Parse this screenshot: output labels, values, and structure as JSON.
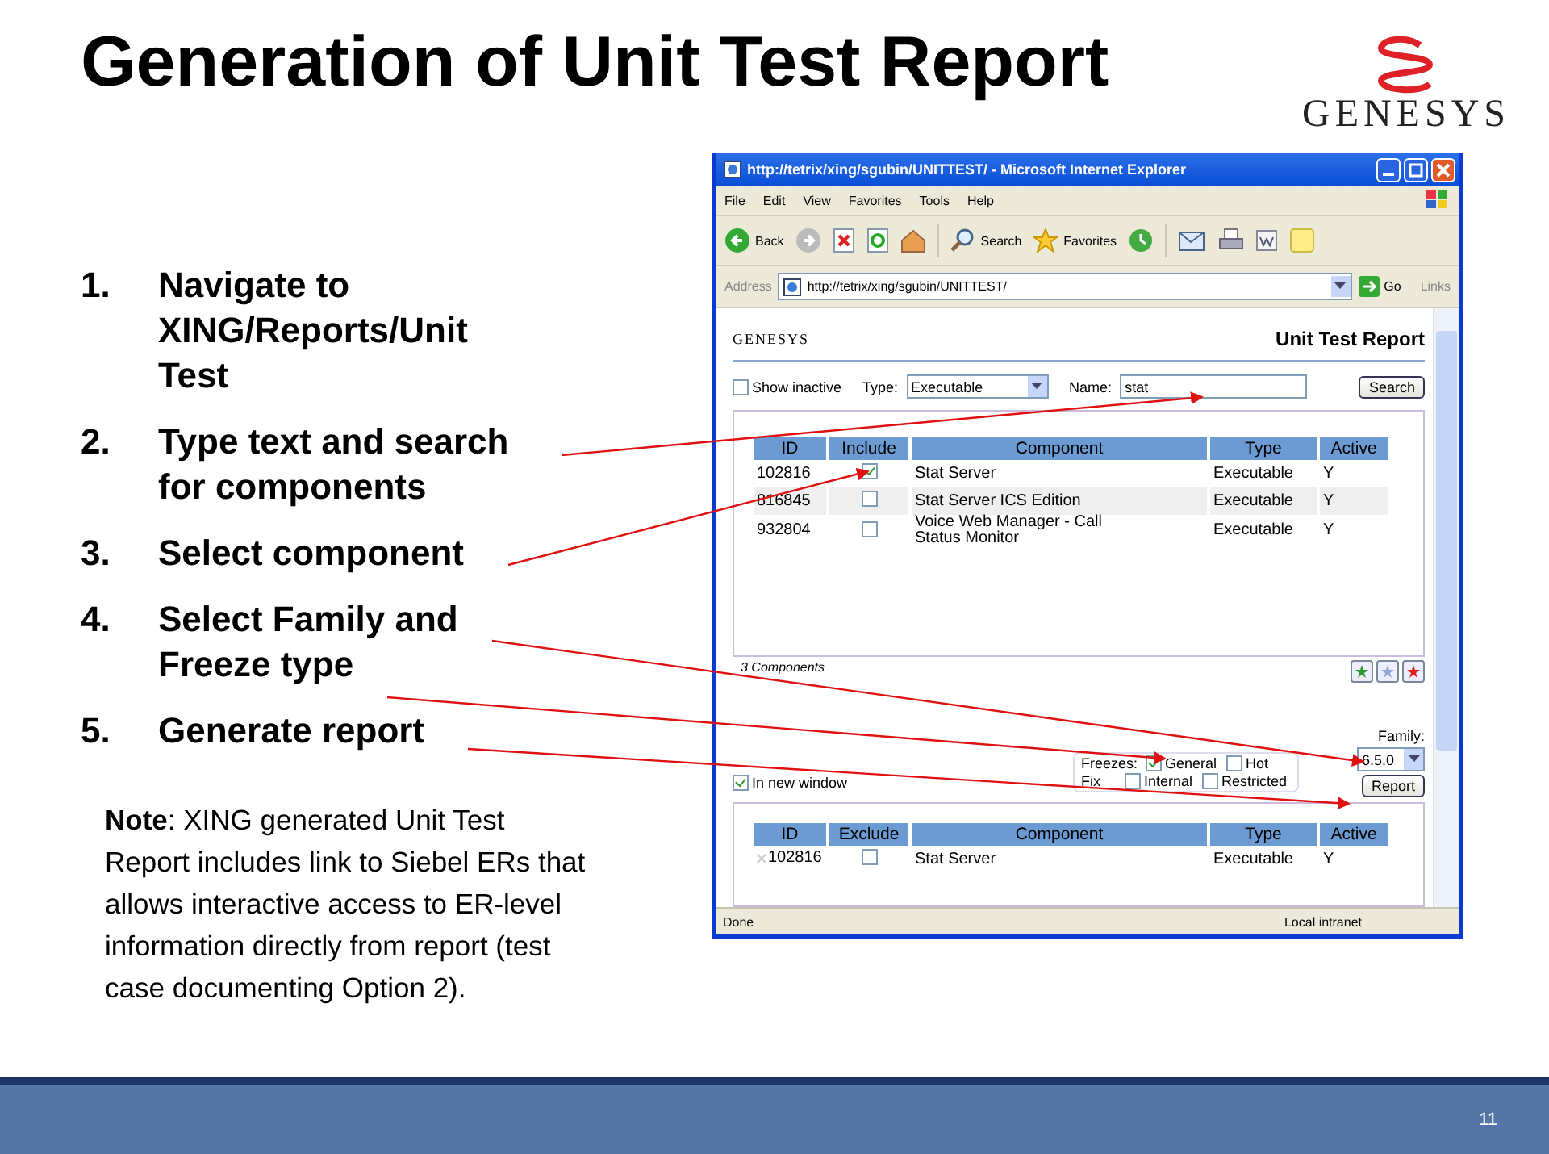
{
  "title": "Generation of Unit Test Report",
  "logo": "GENESYS",
  "steps": [
    {
      "number": "1.",
      "text": "Navigate to XING/Reports/Unit Test"
    },
    {
      "number": "2.",
      "text": "Type text and search for components"
    },
    {
      "number": "3.",
      "text": "Select component"
    },
    {
      "number": "4.",
      "text": "Select Family and Freeze type"
    },
    {
      "number": "5.",
      "text": "Generate report"
    }
  ],
  "note": "**Note**: XING generated Unit Test Report includes link to Siebel ERs that allows interactive access to ER-level information directly from report (test case documenting Option 2).",
  "browser": {
    "window_title": "http://tetrix/xing/sgubin/UNITTEST/ - Microsoft Internet Explorer",
    "menu": [
      "File",
      "Edit",
      "View",
      "Favorites",
      "Tools",
      "Help"
    ],
    "toolbar": {
      "back": "Back",
      "search": "Search",
      "favorites": "Favorites"
    },
    "address_label": "Address",
    "url": "http://tetrix/xing/sgubin/UNITTEST/",
    "go": "Go",
    "links": "Links",
    "page": {
      "logo": "GENESYS",
      "heading": "Unit Test Report",
      "show_inactive": {
        "label": "Show inactive",
        "checked": false
      },
      "type_label": "Type:",
      "type_value": "Executable",
      "name_label": "Name:",
      "name_value": "stat",
      "search_button": "Search",
      "columns": [
        "ID",
        "Include",
        "Component",
        "Type",
        "Active"
      ],
      "rows": [
        {
          "id": "102816",
          "checked": true,
          "component": "Stat Server",
          "type": "Executable",
          "active": "Y"
        },
        {
          "id": "816845",
          "checked": false,
          "component": "Stat Server ICS Edition",
          "type": "Executable",
          "active": "Y"
        },
        {
          "id": "932804",
          "checked": false,
          "component": "Voice Web Manager - Call Status Monitor",
          "type": "Executable",
          "active": "Y"
        }
      ],
      "count": "3 Components",
      "star_buttons": [
        {
          "color": "#2e9a2e"
        },
        {
          "color": "#8fa8d8"
        },
        {
          "color": "#e02020"
        }
      ],
      "in_new_window": {
        "label": "In new window",
        "checked": true
      },
      "freezes_label": "Freezes:",
      "freezes": [
        {
          "label": "General",
          "checked": true
        },
        {
          "label": "Hot",
          "checked": false
        }
      ],
      "fix_label": "Fix",
      "fix": [
        {
          "label": "Internal",
          "checked": false
        },
        {
          "label": "Restricted",
          "checked": false
        }
      ],
      "family_label": "Family:",
      "family_value": "6.5.0",
      "report_button": "Report",
      "columns_2": [
        "ID",
        "Exclude",
        "Component",
        "Type",
        "Active"
      ],
      "rows_2": [
        {
          "id": "102816",
          "checked": false,
          "component": "Stat Server",
          "type": "Executable",
          "active": "Y"
        }
      ]
    },
    "status": "Done",
    "zone": "Local intranet"
  },
  "page_number": "11"
}
